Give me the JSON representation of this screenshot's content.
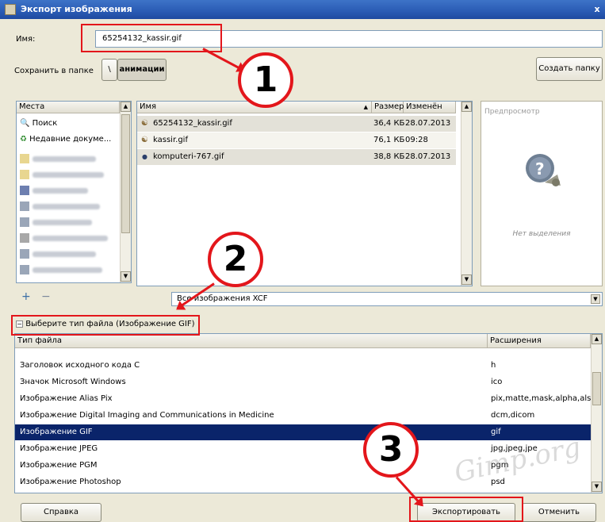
{
  "window": {
    "title": "Экспорт изображения",
    "close": "x"
  },
  "name_row": {
    "label": "Имя:",
    "value": "65254132_kassir.gif"
  },
  "folder_row": {
    "label": "Сохранить в папке",
    "path_root": "\\",
    "path_current": "анимации",
    "create_folder": "Создать папку"
  },
  "places": {
    "header": "Места",
    "items": [
      {
        "label": "Поиск",
        "icon": "search-icon"
      },
      {
        "label": "Недавние докуме...",
        "icon": "recent-icon"
      }
    ],
    "add": "+",
    "remove": "−"
  },
  "files": {
    "columns": [
      "Имя",
      "Размер",
      "Изменён"
    ],
    "rows": [
      {
        "name": "65254132_kassir.gif",
        "size": "36,4 КБ",
        "modified": "28.07.2013"
      },
      {
        "name": "kassir.gif",
        "size": "76,1 КБ",
        "modified": "09:28"
      },
      {
        "name": "komputeri-767.gif",
        "size": "38,8 КБ",
        "modified": "28.07.2013"
      }
    ]
  },
  "preview": {
    "header": "Предпросмотр",
    "empty": "Нет выделения"
  },
  "filter": {
    "value": "Все изображения XCF"
  },
  "filetype": {
    "toggle_label": "Выберите тип файла (Изображение GIF)",
    "columns": [
      "Тип файла",
      "Расширения"
    ],
    "rows": [
      {
        "type": "Заголовок исходного кода С",
        "ext": "h"
      },
      {
        "type": "Значок Microsoft Windows",
        "ext": "ico"
      },
      {
        "type": "Изображение Alias Pix",
        "ext": "pix,matte,mask,alpha,als"
      },
      {
        "type": "Изображение Digital Imaging and Communications in Medicine",
        "ext": "dcm,dicom"
      },
      {
        "type": "Изображение GIF",
        "ext": "gif"
      },
      {
        "type": "Изображение JPEG",
        "ext": "jpg,jpeg,jpe"
      },
      {
        "type": "Изображение PGM",
        "ext": "pgm"
      },
      {
        "type": "Изображение Photoshop",
        "ext": "psd"
      }
    ],
    "selected_index": 4
  },
  "buttons": {
    "help": "Справка",
    "export": "Экспортировать",
    "cancel": "Отменить"
  },
  "annotations": {
    "one": "1",
    "two": "2",
    "three": "3"
  },
  "watermark": "Gimp.org",
  "colors": {
    "highlight": "#e3161b",
    "selection": "#0a246a",
    "titlebar": "#2a5bb4"
  }
}
